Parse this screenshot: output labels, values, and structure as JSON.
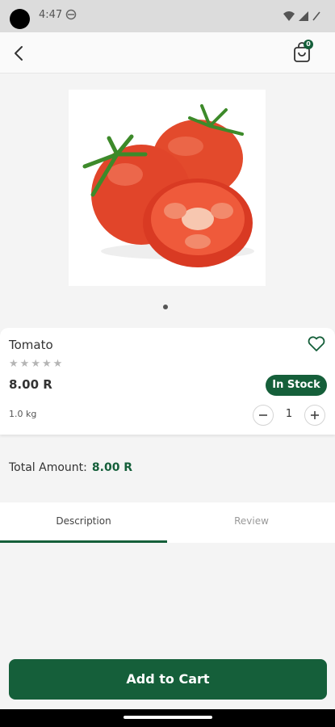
{
  "status_bar": {
    "time": "4:47"
  },
  "header": {
    "cart_count": "0"
  },
  "product": {
    "name": "Tomato",
    "rating_stars": [
      "★",
      "★",
      "★",
      "★",
      "★"
    ],
    "price": "8.00 R",
    "stock_status": "In Stock",
    "weight": "1.0 kg",
    "quantity": "1"
  },
  "total": {
    "label": "Total Amount:",
    "value": "8.00 R"
  },
  "tabs": [
    {
      "label": "Description",
      "active": true
    },
    {
      "label": "Review",
      "active": false
    }
  ],
  "actions": {
    "add_to_cart": "Add to Cart"
  },
  "colors": {
    "brand_green": "#155f3a",
    "tomato_red": "#e1452a"
  }
}
